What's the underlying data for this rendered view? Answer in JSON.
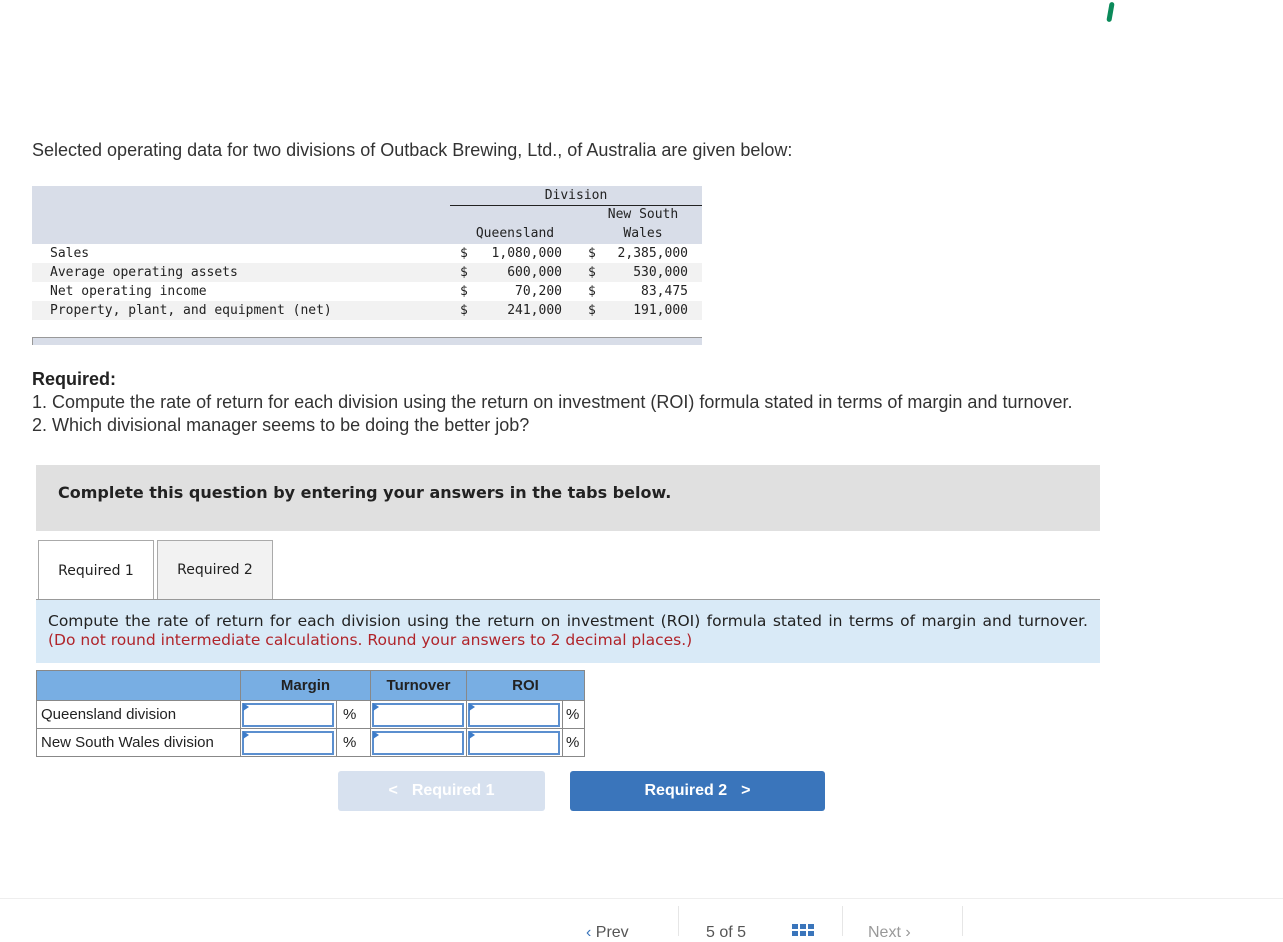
{
  "intro": "Selected operating data for two divisions of Outback Brewing, Ltd., of Australia are given below:",
  "data_table": {
    "group_header": "Division",
    "col1_header": "Queensland",
    "col2_header_line1": "New South",
    "col2_header_line2": "Wales",
    "currency_symbol": "$",
    "rows": [
      {
        "label": "Sales",
        "q": "1,080,000",
        "nsw": "2,385,000"
      },
      {
        "label": "Average operating assets",
        "q": "600,000",
        "nsw": "530,000"
      },
      {
        "label": "Net operating income",
        "q": "70,200",
        "nsw": "83,475"
      },
      {
        "label": "Property, plant, and equipment (net)",
        "q": "241,000",
        "nsw": "191,000"
      }
    ]
  },
  "required": {
    "title": "Required:",
    "items": [
      "1. Compute the rate of return for each division using the return on investment (ROI) formula stated in terms of margin and turnover.",
      "2. Which divisional manager seems to be doing the better job?"
    ]
  },
  "banner": "Complete this question by entering your answers in the tabs below.",
  "tabs": [
    {
      "label": "Required 1",
      "active": true
    },
    {
      "label": "Required 2",
      "active": false
    }
  ],
  "instructions": {
    "main": "Compute the rate of return for each division using the return on investment (ROI) formula stated in terms of margin and turnover. ",
    "note": "(Do not round intermediate calculations. Round your answers to 2 decimal places.)"
  },
  "answer_table": {
    "headers": [
      "Margin",
      "Turnover",
      "ROI"
    ],
    "percent_symbol": "%",
    "rows": [
      {
        "label": "Queensland division",
        "margin": "",
        "turnover": "",
        "roi": ""
      },
      {
        "label": "New South Wales division",
        "margin": "",
        "turnover": "",
        "roi": ""
      }
    ]
  },
  "nav_buttons": {
    "prev_label": "Required 1",
    "next_label": "Required 2",
    "prev_icon": "<",
    "next_icon": ">"
  },
  "footer": {
    "prev": "Prev",
    "page": "5 of 5",
    "next": "Next"
  }
}
